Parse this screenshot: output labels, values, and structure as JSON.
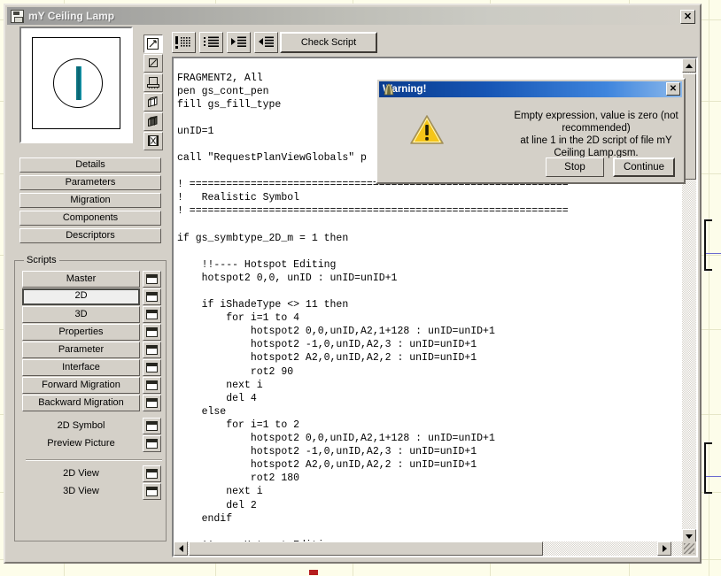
{
  "window": {
    "title": "mY Ceiling Lamp",
    "icon": "document-save-icon",
    "close_label": "✕"
  },
  "toolbar": {
    "buttons": [
      {
        "name": "syntax-highlight-toggle",
        "icon": "exclamation-grid-icon"
      },
      {
        "name": "format-script",
        "icon": "list-format-icon"
      },
      {
        "name": "indent-increase",
        "icon": "indent-right-icon"
      },
      {
        "name": "indent-decrease",
        "icon": "indent-left-icon"
      }
    ],
    "check_script_label": "Check Script"
  },
  "preview": {
    "shape": "ceiling-lamp-2d-symbol",
    "accent_color": "#0e7c8c"
  },
  "view_toolbar": {
    "items": [
      {
        "name": "2d-symbol-view",
        "icon": "pencil-square-icon",
        "selected": true
      },
      {
        "name": "preview-picture-view",
        "icon": "picture-square-icon",
        "selected": false
      },
      {
        "name": "floor-plan-view",
        "icon": "floorplan-icon",
        "selected": false
      },
      {
        "name": "3d-wireframe-view",
        "icon": "cube-wire-icon",
        "selected": false
      },
      {
        "name": "3d-shaded-view",
        "icon": "cube-solid-icon",
        "selected": false
      },
      {
        "name": "animation-view",
        "icon": "film-strip-icon",
        "selected": false
      }
    ]
  },
  "nav": {
    "items": [
      {
        "label": "Details"
      },
      {
        "label": "Parameters"
      },
      {
        "label": "Migration"
      },
      {
        "label": "Components"
      },
      {
        "label": "Descriptors"
      }
    ]
  },
  "scripts": {
    "legend": "Scripts",
    "items": [
      {
        "label": "Master",
        "active": false,
        "button": true
      },
      {
        "label": "2D",
        "active": true,
        "button": true
      },
      {
        "label": "3D",
        "active": false,
        "button": true
      },
      {
        "label": "Properties",
        "active": false,
        "button": true
      },
      {
        "label": "Parameter",
        "active": false,
        "button": true
      },
      {
        "label": "Interface",
        "active": false,
        "button": true
      },
      {
        "label": "Forward Migration",
        "active": false,
        "button": true
      },
      {
        "label": "Backward Migration",
        "active": false,
        "button": true
      },
      {
        "label": "2D Symbol",
        "active": false,
        "button": false
      },
      {
        "label": "Preview Picture",
        "active": false,
        "button": false
      },
      {
        "label": "2D View",
        "active": false,
        "button": false
      },
      {
        "label": "3D View",
        "active": false,
        "button": false
      }
    ],
    "window_icon": "window-open-icon"
  },
  "editor": {
    "code": "FRAGMENT2, All\npen gs_cont_pen\nfill gs_fill_type\n\nunID=1\n\ncall \"RequestPlanViewGlobals\" p\n\n! ==============================================================\n!   Realistic Symbol\n! ==============================================================\n\nif gs_symbtype_2D_m = 1 then\n\n    !!---- Hotspot Editing\n    hotspot2 0,0, unID : unID=unID+1\n\n    if iShadeType <> 11 then\n        for i=1 to 4\n            hotspot2 0,0,unID,A2,1+128 : unID=unID+1\n            hotspot2 -1,0,unID,A2,3 : unID=unID+1\n            hotspot2 A2,0,unID,A2,2 : unID=unID+1\n            rot2 90\n        next i\n        del 4\n    else\n        for i=1 to 2\n            hotspot2 0,0,unID,A2,1+128 : unID=unID+1\n            hotspot2 -1,0,unID,A2,3 : unID=unID+1\n            hotspot2 A2,0,unID,A2,2 : unID=unID+1\n            rot2 180\n        next i\n        del 2\n    endif\n\n    !!---- Hotspot Editing"
  },
  "warning_dialog": {
    "title": "Warning!",
    "title_icon": "archicad-warning-icon",
    "icon": "warning-triangle-icon",
    "message_line1": "Empty expression, value is zero (not recommended)",
    "message_line2": "at line 1 in the 2D script of file mY Ceiling Lamp.gsm.",
    "stop_label": "Stop",
    "continue_label": "Continue",
    "close_label": "✕",
    "accent_color": "#1655b4"
  }
}
